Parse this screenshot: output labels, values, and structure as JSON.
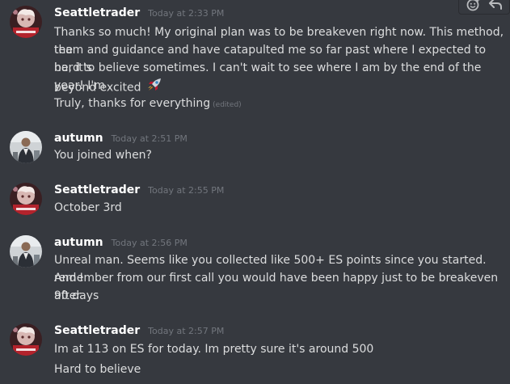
{
  "toolbar": {
    "icons": [
      "add-reaction-icon",
      "reply-icon"
    ]
  },
  "messages": [
    {
      "username": "Seattletrader",
      "timestamp": "Today at 2:33 PM",
      "avatar": "avatar-seattletrader",
      "lines": [
        "Thanks so much! My original plan was to be breakeven right now. This method, the",
        "team and guidance and have catapulted me so far past where I expected to be, it's",
        "hard to believe sometimes. I can't wait to see where I am by the end of the year! I'm",
        "beyond excited",
        "Truly, thanks for everything"
      ],
      "emoji": "rocket-emoji",
      "edited_label": "(edited)"
    },
    {
      "username": "autumn",
      "timestamp": "Today at 2:51 PM",
      "avatar": "avatar-autumn",
      "lines": [
        "You joined when?"
      ]
    },
    {
      "username": "Seattletrader",
      "timestamp": "Today at 2:55 PM",
      "avatar": "avatar-seattletrader",
      "lines": [
        "October 3rd"
      ]
    },
    {
      "username": "autumn",
      "timestamp": "Today at 2:56 PM",
      "avatar": "avatar-autumn",
      "lines": [
        "Unreal man. Seems like you collected like 500+ ES points since you started. And I",
        "remember from our first call you would have been happy just to be breakeven after",
        "90 days"
      ]
    },
    {
      "username": "Seattletrader",
      "timestamp": "Today at 2:57 PM",
      "avatar": "avatar-seattletrader",
      "lines": [
        "Im at 113 on ES for today. Im pretty sure it's around 500",
        "Hard to believe"
      ]
    }
  ],
  "colors": {
    "background": "#36393f",
    "username": "#ffffff",
    "text": "#dcddde",
    "timestamp": "#72767d"
  }
}
